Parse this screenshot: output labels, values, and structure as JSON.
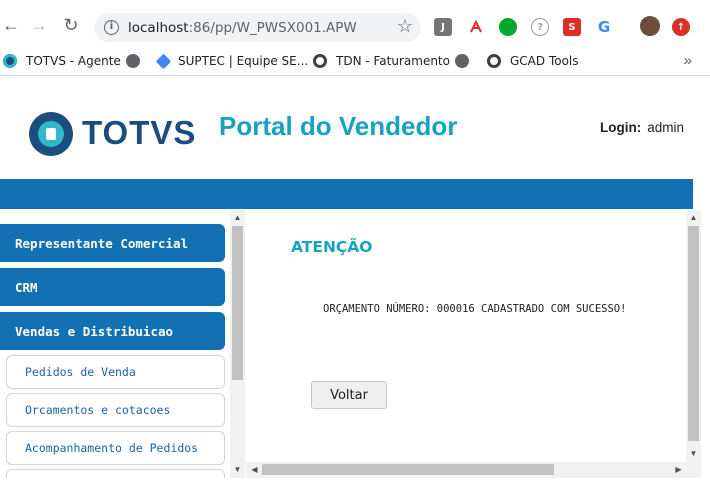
{
  "browser": {
    "url_host": "localhost",
    "url_path": ":86/pp/W_PWSX001.APW",
    "extensions": [
      "j-extension-icon",
      "pdf-extension-icon",
      "evernote-extension-icon",
      "help-extension-icon",
      "s-extension-icon",
      "google-extension-icon",
      "profile-avatar",
      "update-icon"
    ],
    "bookmarks": [
      {
        "label": "TOTVS - Agente",
        "icon": "totvs-icon"
      },
      {
        "label": "SUPTEC | Equipe SE...",
        "icon": "diamond-icon"
      },
      {
        "label": "TDN - Faturamento",
        "icon": "tdn-icon"
      },
      {
        "label": "GCAD Tools",
        "icon": "gcad-icon"
      }
    ],
    "bookmarks_more": "»"
  },
  "header": {
    "logo_text": "TOTVS",
    "title": "Portal do Vendedor",
    "login_label": "Login:",
    "login_user": "admin"
  },
  "menu": {
    "sections": [
      "Representante Comercial",
      "CRM",
      "Vendas e Distribuicao"
    ],
    "subitems": [
      "Pedidos de Venda",
      "Orcamentos e cotacoes",
      "Acompanhamento de Pedidos"
    ]
  },
  "content": {
    "heading": "ATENÇÃO",
    "message": "ORÇAMENTO NÚMERO: 000016 CADASTRADO COM SUCESSO!",
    "back_button": "Voltar"
  },
  "colors": {
    "brand_blue": "#1270b3",
    "accent_teal": "#17a3c0",
    "logo_navy": "#1b4d7e"
  }
}
